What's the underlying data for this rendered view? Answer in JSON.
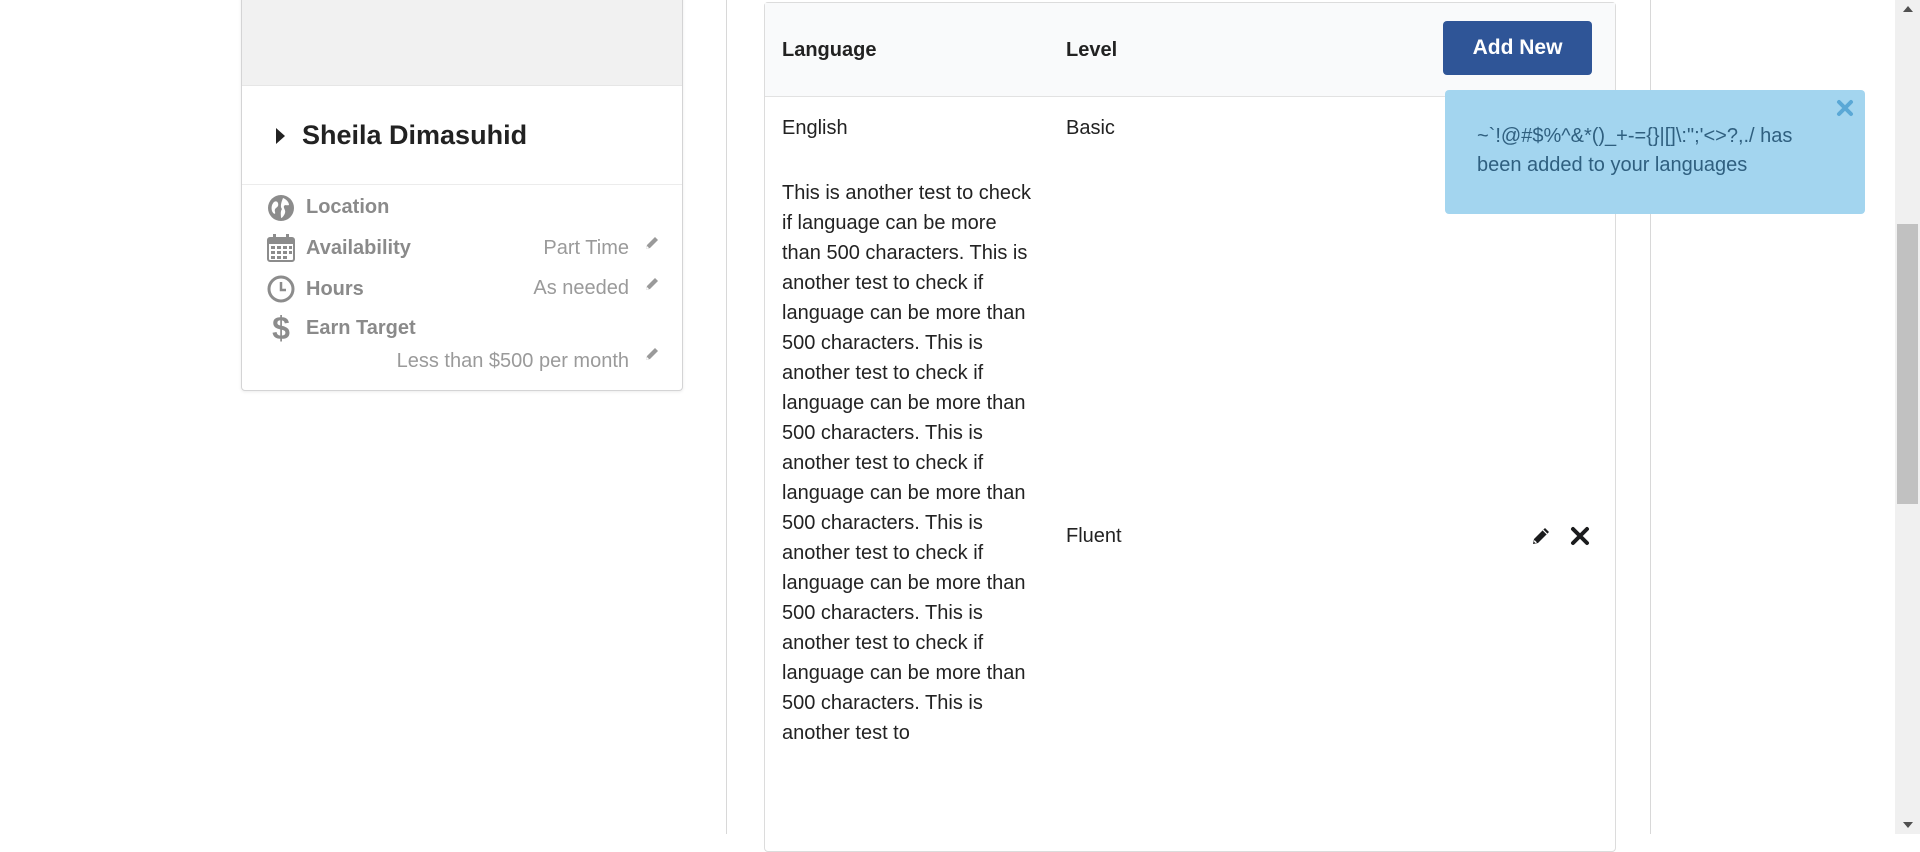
{
  "profile": {
    "name": "Sheila Dimasuhid",
    "details": {
      "location_label": "Location",
      "availability_label": "Availability",
      "availability_value": "Part Time",
      "hours_label": "Hours",
      "hours_value": "As needed",
      "earn_target_label": "Earn Target",
      "earn_target_value": "Less than $500 per month"
    }
  },
  "languages": {
    "headers": {
      "language": "Language",
      "level": "Level"
    },
    "add_button": "Add New",
    "rows": [
      {
        "language": "English",
        "level": "Basic"
      },
      {
        "language": "This is another test to check if language can be more than 500 characters. This is another test to check if language can be more than 500 characters. This is another test to check if language can be more than 500 characters. This is another test to check if language can be more than 500 characters. This is another test to check if language can be more than 500 characters. This is another test to check if language can be more than 500 characters. This is another test to",
        "level": "Fluent"
      }
    ]
  },
  "toast": {
    "message": "~`!@#$%^&*()_+-={}|[]\\:\";'<>?,./ has been added to your languages",
    "color": "#a3d5ef"
  },
  "colors": {
    "primary_button": "#2f5597",
    "toast_bg": "#a3d5ef"
  }
}
